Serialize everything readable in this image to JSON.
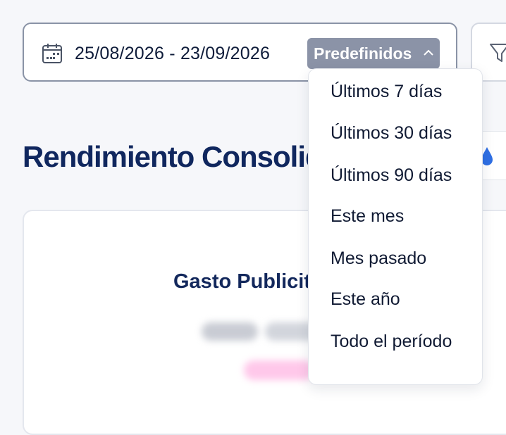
{
  "date_filter": {
    "range_text": "25/08/2026 - 23/09/2026",
    "preset_button_label": "Predefinidos",
    "calendar_icon": "calendar-icon",
    "preset_chevron_icon": "chevron-up-icon",
    "preset_options": [
      "Últimos 7 días",
      "Últimos 30 días",
      "Últimos 90 días",
      "Este mes",
      "Mes pasado",
      "Este año",
      "Todo el período"
    ]
  },
  "filter_button": {
    "icon": "filter-icon"
  },
  "page": {
    "title": "Rendimiento Consolid"
  },
  "card": {
    "title": "Gasto Publicit"
  },
  "colors": {
    "title_navy": "#10275e",
    "preset_button_bg": "#8b93a7",
    "accent_blue": "#2f6fe4",
    "blurred_pink": "#ffc8ea"
  }
}
